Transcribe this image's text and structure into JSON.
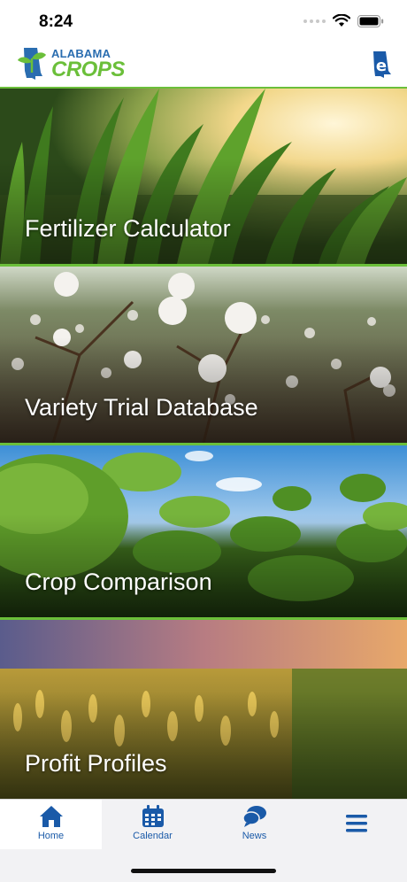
{
  "status": {
    "time": "8:24"
  },
  "header": {
    "logo_top": "ALABAMA",
    "logo_bottom": "CROPS"
  },
  "tiles": [
    {
      "label": "Fertilizer Calculator"
    },
    {
      "label": "Variety Trial Database"
    },
    {
      "label": "Crop Comparison"
    },
    {
      "label": "Profit Profiles"
    }
  ],
  "tabs": [
    {
      "label": "Home",
      "icon": "home-icon"
    },
    {
      "label": "Calendar",
      "icon": "calendar-icon"
    },
    {
      "label": "News",
      "icon": "news-icon"
    },
    {
      "label": "",
      "icon": "menu-icon"
    }
  ],
  "colors": {
    "accent_green": "#6bbf3a",
    "brand_blue": "#1a5aa8"
  }
}
